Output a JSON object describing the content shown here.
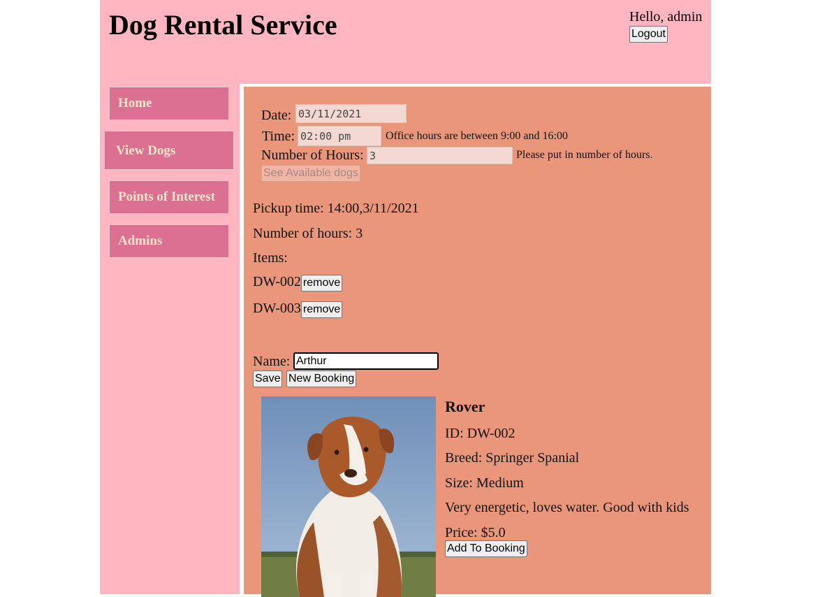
{
  "header": {
    "title": "Dog Rental Service",
    "greeting": "Hello, admin",
    "logout_label": "Logout"
  },
  "nav": {
    "items": [
      {
        "label": "Home"
      },
      {
        "label": "View Dogs",
        "active": true
      },
      {
        "label": "Points of Interest"
      },
      {
        "label": "Admins"
      }
    ]
  },
  "booking_form": {
    "date_label": "Date:",
    "date_value": "03/11/2021",
    "time_label": "Time:",
    "time_value": "02:00 pm",
    "time_hint": "Office hours are between 9:00 and 16:00",
    "hours_label": "Number of Hours:",
    "hours_value": "3",
    "hours_hint": "Please put in number of hours.",
    "see_dogs_label": "See Available dogs"
  },
  "summary": {
    "pickup": "Pickup time: 14:00,3/11/2021",
    "hours": "Number of hours: 3",
    "items_label": "Items:",
    "items": [
      {
        "id": "DW-002",
        "remove_label": "remove"
      },
      {
        "id": "DW-003",
        "remove_label": "remove"
      }
    ]
  },
  "customer": {
    "name_label": "Name:",
    "name_value": "Arthur",
    "save_label": "Save",
    "new_booking_label": "New Booking"
  },
  "dog": {
    "name": "Rover",
    "id": "ID: DW-002",
    "breed": "Breed: Springer Spanial",
    "size": "Size: Medium",
    "description": "Very energetic, loves water. Good with kids",
    "price": "Price: $5.0",
    "add_label": "Add To Booking"
  },
  "colors": {
    "page_bg": "#ffb6c1",
    "nav_bg": "#db7093",
    "nav_text": "#fde6c8",
    "main_bg": "#e9967a"
  }
}
